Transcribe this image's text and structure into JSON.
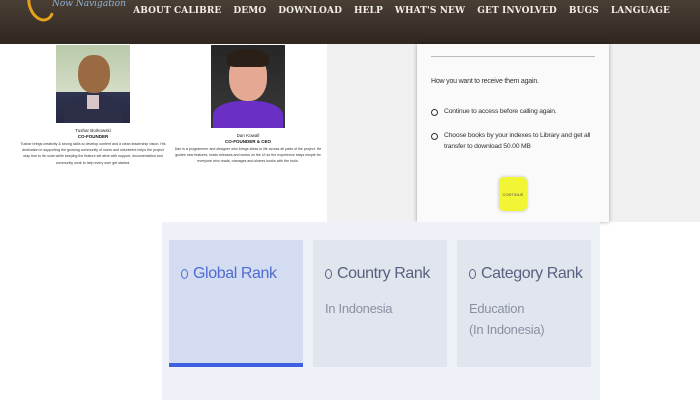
{
  "header": {
    "logo_text": "Now Navigation",
    "nav": [
      "About Calibre",
      "Demo",
      "Download",
      "Help",
      "What's New",
      "Get Involved",
      "Bugs",
      "Language"
    ]
  },
  "team": {
    "members": [
      {
        "name": "Tushar Borkowski",
        "role": "CO-FOUNDER",
        "bio": "Tushar brings creativity & strong skills to develop content and a clean leadership vision. His dedication in supporting the growing community of users and volunteers helps the project stay true to its roots while keeping the feature set alive with support, documentation and community work to help every user get started."
      },
      {
        "name": "Dan Kowall",
        "role": "CO-FOUNDER & CEO",
        "bio": "Dan is a programmer and designer who brings ideas to life across all parts of the project. He guides new features, leads releases and works on the UI so the experience stays simple for everyone who reads, manages and shares books with the tools."
      }
    ]
  },
  "dialog": {
    "message": "How you want to receive them again.",
    "option1": "Continue to access before calling again.",
    "option2_line1": "Choose books by your indexes to Library and get all",
    "option2_line2": "transfer to download 50.00 MB",
    "button": "CONTINUE"
  },
  "rank": {
    "cards": [
      {
        "title": "Global Rank",
        "sub1": "",
        "sub2": "",
        "active": true
      },
      {
        "title": "Country Rank",
        "sub1": "In Indonesia",
        "sub2": "",
        "active": false
      },
      {
        "title": "Category Rank",
        "sub1": "Education",
        "sub2": "(In Indonesia)",
        "active": false
      }
    ]
  },
  "colors": {
    "nav_bg": "#3a3129",
    "logo_accent": "#e7a21c",
    "rank_active": "#3d62e1",
    "dialog_button": "#f2f533"
  }
}
